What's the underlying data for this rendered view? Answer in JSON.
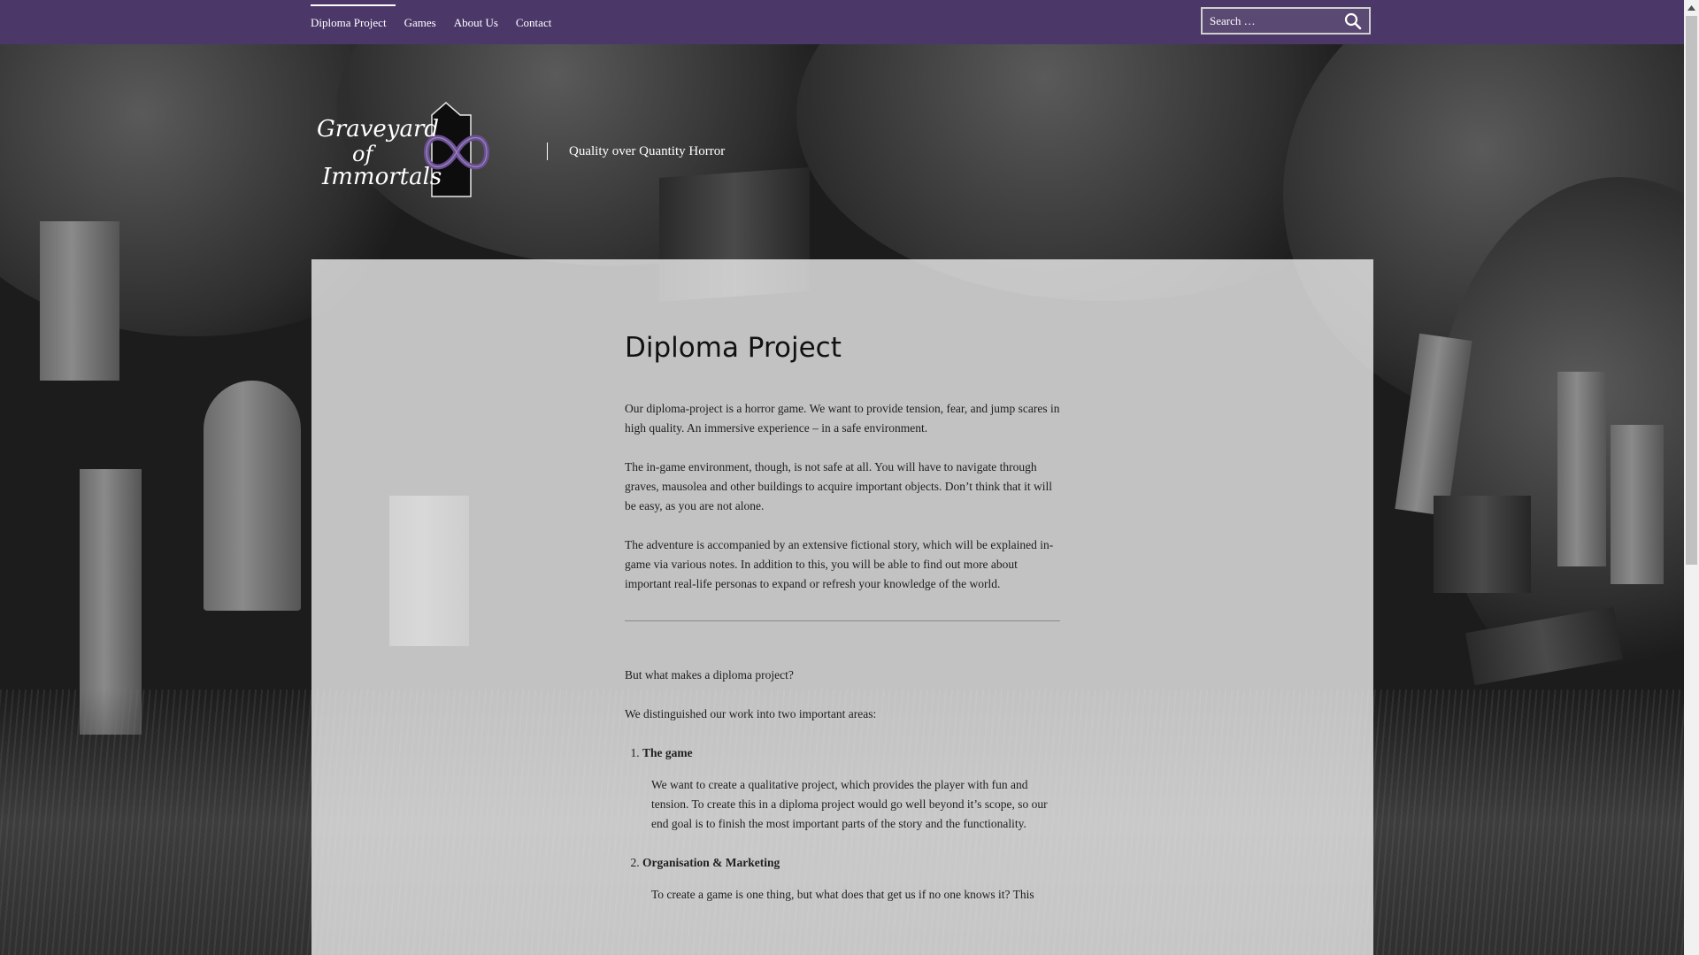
{
  "nav": {
    "items": [
      {
        "label": "Diploma Project",
        "active": true
      },
      {
        "label": "Games",
        "active": false
      },
      {
        "label": "About Us",
        "active": false
      },
      {
        "label": "Contact",
        "active": false
      }
    ]
  },
  "search": {
    "placeholder": "Search …",
    "icon": "search-icon"
  },
  "site": {
    "logo_line1": "Graveyard",
    "logo_line2": "of",
    "logo_line3": "Immortals",
    "tagline": "Quality over Quantity Horror"
  },
  "colors": {
    "topbar": "#4b3869",
    "logo_infinity": "#6b4f93"
  },
  "article": {
    "title": "Diploma Project",
    "p1": "Our diploma-project is a horror game. We want to provide tension, fear, and jump scares in high quality. An immersive experience – in a safe environment.",
    "p2": "The in-game environment, though, is not safe at all. You will have to navigate through graves, mausolea and other buildings to acquire important objects. Don’t think that it will be easy, as you are not alone.",
    "p3": "The adventure is accompanied by an extensive fictional story, which will be explained in-game via various notes. In addition to this, you will be able to find out more about important real-life personas to expand or refresh your knowledge of the world.",
    "p4": "But what makes a diploma project?",
    "p5": "We distinguished our work into two important areas:",
    "list": [
      {
        "title": "The game",
        "text": "We want to create a qualitative project, which provides the player with fun and tension. To create this in a diploma project would go well beyond it’s scope, so our end goal is to finish the most important parts of the story and the functionality."
      },
      {
        "title": "Organisation & Marketing",
        "text": "To create a game is one thing, but what does that get us if no one knows it? This"
      }
    ]
  }
}
